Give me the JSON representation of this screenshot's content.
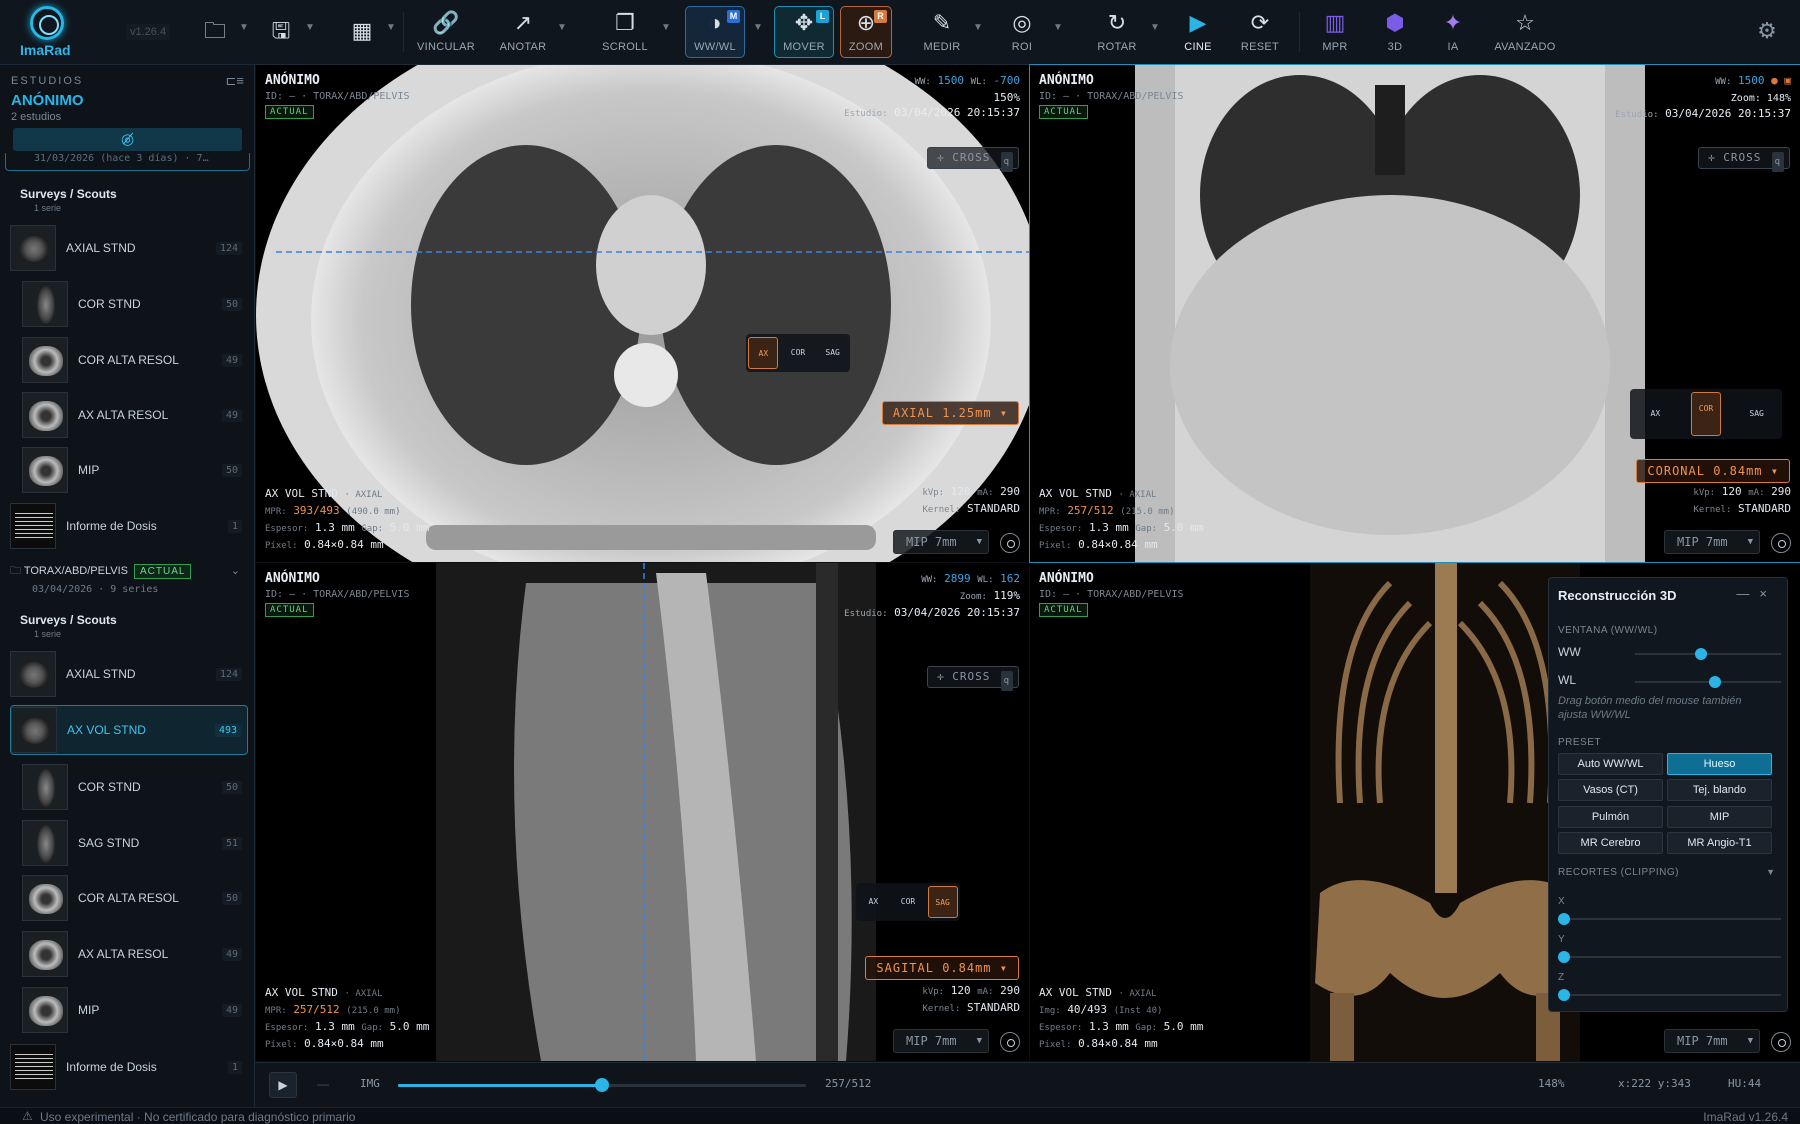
{
  "app": {
    "name": "ImaRad",
    "version": "v1.26.4"
  },
  "toolbar": {
    "vincular": "VINCULAR",
    "anotar": "ANOTAR",
    "scroll": "SCROLL",
    "wwwl": "WW/WL",
    "mover": "MOVER",
    "zoom": "ZOOM",
    "medir": "MEDIR",
    "roi": "ROI",
    "rotar": "ROTAR",
    "cine": "CINE",
    "reset": "RESET",
    "mpr": "MPR",
    "tresd": "3D",
    "ia": "IA",
    "avanzado": "AVANZADO",
    "badge_m": "M",
    "badge_l": "L",
    "badge_r": "R"
  },
  "sidebar": {
    "heading": "ESTUDIOS",
    "patient": "ANÓNIMO",
    "count": "2 estudios",
    "prev_date": "31/03/2026 (hace 3 días) · 7…",
    "study1": [
      {
        "label": "Surveys / Scouts",
        "sub": "1 serie"
      },
      {
        "label": "AXIAL STND",
        "count": "124"
      },
      {
        "label": "COR STND",
        "count": "50"
      },
      {
        "label": "COR ALTA RESOL",
        "count": "49"
      },
      {
        "label": "AX ALTA RESOL",
        "count": "49"
      },
      {
        "label": "MIP",
        "count": "50"
      },
      {
        "label": "Informe de Dosis",
        "count": "1"
      }
    ],
    "study2": {
      "name": "TORAX/ABD/PELVIS",
      "tag": "ACTUAL",
      "date": "03/04/2026 · 9 series"
    },
    "study2_items": [
      {
        "label": "Surveys / Scouts",
        "sub": "1 serie"
      },
      {
        "label": "AXIAL STND",
        "count": "124"
      },
      {
        "label": "AX VOL STND",
        "count": "493"
      },
      {
        "label": "COR STND",
        "count": "50"
      },
      {
        "label": "SAG STND",
        "count": "51"
      },
      {
        "label": "COR ALTA RESOL",
        "count": "50"
      },
      {
        "label": "AX ALTA RESOL",
        "count": "49"
      },
      {
        "label": "MIP",
        "count": "49"
      },
      {
        "label": "Informe de Dosis",
        "count": "1"
      }
    ]
  },
  "common": {
    "patient": "ANÓNIMO",
    "id": "ID: — · TORAX/ABD/PELVIS",
    "tag": "ACTUAL",
    "cross": "CROSS",
    "q": "q",
    "mip": "MIP 7mm",
    "estudio_lbl": "Estudio:",
    "estudio": "03/04/2026 20:15:37",
    "kernel_lbl": "Kernel:",
    "kernel": "STANDARD",
    "kvp_lbl": "kVp:",
    "kvp": "120",
    "ma_lbl": "mA:",
    "ma": "290",
    "pixel_lbl": "Píxel:",
    "pixel": "0.84×0.84 mm",
    "espesor_lbl": "Espesor:",
    "espesor": "1.3 mm",
    "gap_lbl": "Gap:",
    "gap": "5.0 mm",
    "series": "AX VOL STND",
    "axial_small": "· AXIAL",
    "ax": "AX",
    "cor": "COR",
    "sag": "SAG"
  },
  "vp1": {
    "ww_lbl": "WW:",
    "ww": "1500",
    "wl_lbl": "WL:",
    "wl": "-700",
    "zoom": "150%",
    "mpr_lbl": "MPR:",
    "mpr": "393/493",
    "mpr_extra": "(490.0 mm)",
    "plane": "AXIAL 1.25mm"
  },
  "vp2": {
    "ww_lbl": "WW:",
    "ww": "1500",
    "zoom": "Zoom: 148%",
    "mpr_lbl": "MPR:",
    "mpr": "257/512",
    "mpr_extra": "(215.0 mm)",
    "plane": "CORONAL 0.84mm"
  },
  "vp3": {
    "ww_lbl": "WW:",
    "ww": "2899",
    "wl_lbl": "WL:",
    "wl": "162",
    "zoom_lbl": "Zoom:",
    "zoom": "119%",
    "mpr_lbl": "MPR:",
    "mpr": "257/512",
    "mpr_extra": "(215.0 mm)",
    "plane": "SAGITAL 0.84mm"
  },
  "vp4": {
    "img_lbl": "Img:",
    "img": "40/493",
    "img_extra": "(Inst 40)"
  },
  "panel3d": {
    "title": "Reconstrucción 3D",
    "ventana": "VENTANA (WW/WL)",
    "ww": "WW",
    "wl": "WL",
    "ww_value": 0.45,
    "wl_value": 0.55,
    "hint": "Drag botón medio del mouse también ajusta WW/WL",
    "preset": "PRESET",
    "presets": [
      "Auto WW/WL",
      "Hueso",
      "Vasos (CT)",
      "Tej. blando",
      "Pulmón",
      "MIP",
      "MR Cerebro",
      "MR Angio-T1"
    ],
    "recortes": "RECORTES (CLIPPING)",
    "x": "X",
    "y": "Y",
    "z": "Z"
  },
  "bottom": {
    "img_lbl": "IMG",
    "frame": "257/512",
    "slider_value": 0.5,
    "zoom": "148%",
    "coords": "x:222 y:343",
    "hu": "HU:44"
  },
  "status": {
    "warning": "Uso experimental · No certificado para diagnóstico primario",
    "version": "ImaRad v1.26.4"
  }
}
